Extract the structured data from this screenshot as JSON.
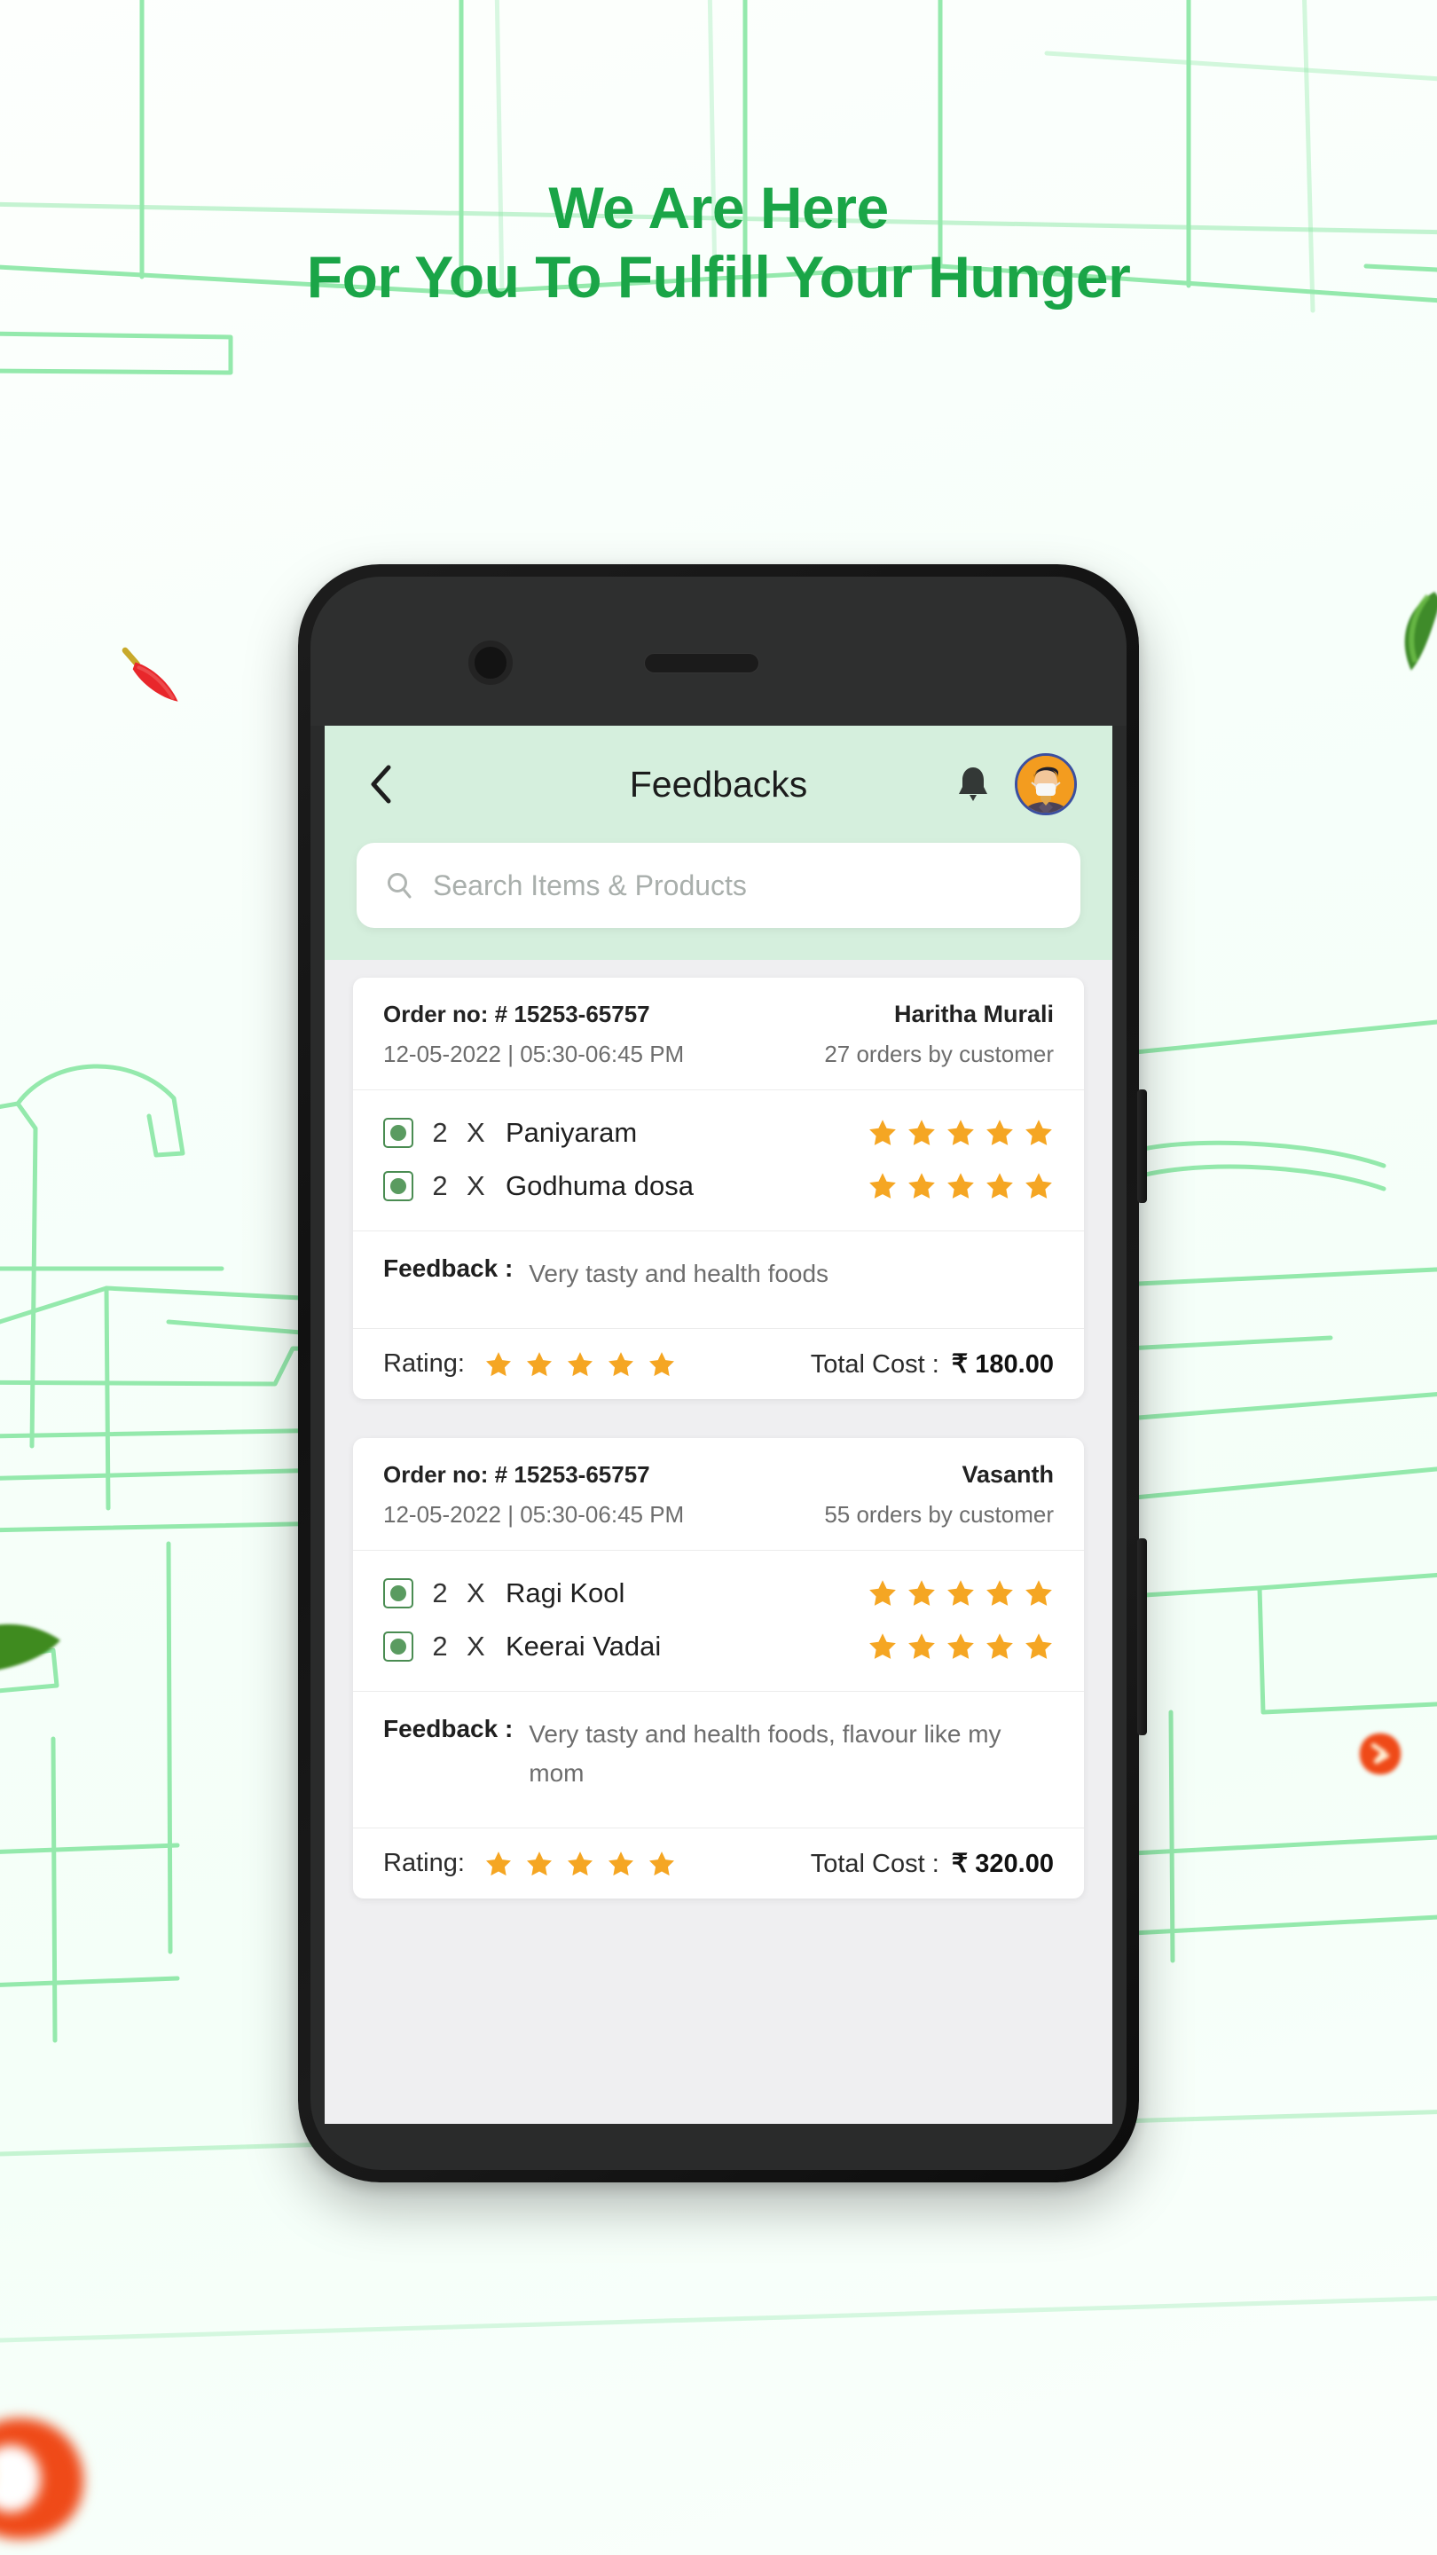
{
  "promo": {
    "headline_line1": "We Are Here",
    "headline_line2": "For You To Fulfill Your Hunger",
    "headline_color": "#1aa547"
  },
  "app": {
    "header": {
      "title": "Feedbacks",
      "back_icon": "chevron-left-icon",
      "bell_icon": "notification-bell-icon",
      "avatar_icon": "user-avatar"
    },
    "search": {
      "placeholder": "Search Items & Products",
      "value": "",
      "icon": "search-icon"
    },
    "accent_green": "#D5EFDD",
    "star_color": "#F5A623",
    "veg_color": "#4a8c52",
    "body_bg": "#EFEFF1"
  },
  "labels": {
    "order_prefix": "Order no: ",
    "feedback_label": "Feedback :",
    "rating_label": "Rating:",
    "total_cost_label": "Total Cost :",
    "multiply": "X"
  },
  "orders": [
    {
      "order_no": "# 15253-65757",
      "datetime": "12-05-2022 | 05:30-06:45 PM",
      "customer_name": "Haritha Murali",
      "customer_orders": "27 orders by customer",
      "items": [
        {
          "qty": "2",
          "name": "Paniyaram",
          "stars": 5
        },
        {
          "qty": "2",
          "name": "Godhuma dosa",
          "stars": 5
        }
      ],
      "feedback": "Very tasty and health foods",
      "rating": 5,
      "total_cost": "₹ 180.00"
    },
    {
      "order_no": "# 15253-65757",
      "datetime": "12-05-2022 | 05:30-06:45 PM",
      "customer_name": "Vasanth",
      "customer_orders": "55 orders by customer",
      "items": [
        {
          "qty": "2",
          "name": "Ragi Kool",
          "stars": 5
        },
        {
          "qty": "2",
          "name": "Keerai Vadai",
          "stars": 5
        }
      ],
      "feedback": "Very tasty and health foods, flavour like my mom",
      "rating": 5,
      "total_cost": "₹ 320.00"
    }
  ],
  "decor": {
    "chili_red": "red-chili-pepper",
    "green_chili": "green-chili-pepper",
    "leaf": "green-leaf",
    "blob_right": "blurred-spice-blob",
    "blob_bottom": "blurred-spice-blob"
  }
}
